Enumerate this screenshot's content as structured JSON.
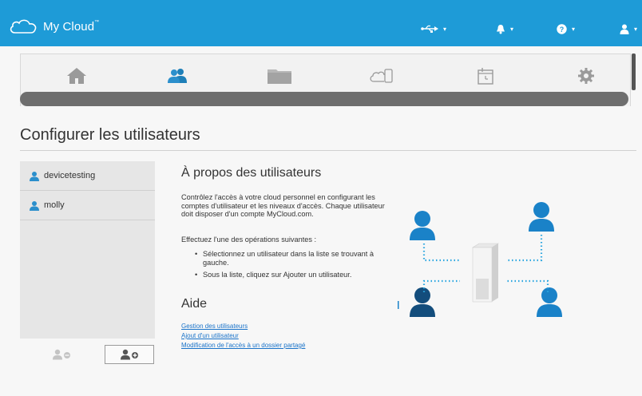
{
  "header": {
    "brand": "My Cloud",
    "brand_tm": "™",
    "usb_menu_icon": "usb-icon",
    "notifications_icon": "bell-icon",
    "help_icon": "help-icon",
    "account_icon": "user-icon",
    "accent_color": "#1e9bd7"
  },
  "nav": {
    "items": [
      {
        "name": "home",
        "icon": "home-icon"
      },
      {
        "name": "users",
        "icon": "users-icon",
        "active": true
      },
      {
        "name": "shares",
        "icon": "folder-icon"
      },
      {
        "name": "cloud-access",
        "icon": "cloud-device-icon"
      },
      {
        "name": "backups",
        "icon": "backup-clock-icon"
      },
      {
        "name": "settings",
        "icon": "gear-icon"
      }
    ]
  },
  "page": {
    "title": "Configurer les utilisateurs"
  },
  "users": {
    "list": [
      "devicetesting",
      "molly"
    ],
    "remove_icon": "remove-user-icon",
    "add_icon": "add-user-icon"
  },
  "about": {
    "title": "À propos des utilisateurs",
    "description": "Contrôlez l'accès à votre cloud personnel en configurant les comptes d'utilisateur et les niveaux d'accès. Chaque utilisateur doit disposer d'un compte MyCloud.com.",
    "ops_intro": "Effectuez l'une des opérations suivantes :",
    "steps": [
      "Sélectionnez un utilisateur dans la liste se trouvant à gauche.",
      "Sous la liste, cliquez sur Ajouter un utilisateur."
    ]
  },
  "help": {
    "title": "Aide",
    "links": [
      "Gestion des utilisateurs",
      "Ajout d'un utilisateur",
      "Modification de l'accès à un dossier partagé"
    ]
  }
}
